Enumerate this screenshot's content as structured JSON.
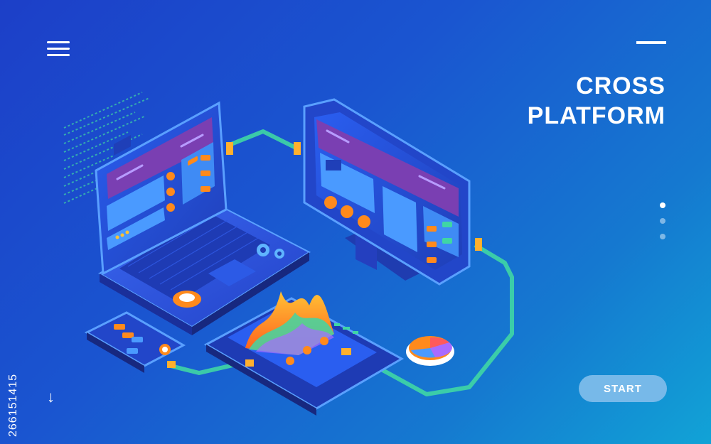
{
  "hero": {
    "title_line1": "CROSS",
    "title_line2": "PLATFORM",
    "start_label": "START"
  },
  "side_id": "266151415",
  "colors": {
    "accent_orange": "#ff8a1c",
    "accent_purple": "#6a4bb0",
    "pipe_green": "#3fd6a4",
    "button_blue": "#77b9e9"
  },
  "icons": {
    "menu": "hamburger-icon",
    "scroll": "arrow-down-icon",
    "mail": "mail-icon",
    "gear": "gear-icon",
    "star": "star-icon",
    "chat": "chat-bubble-icon"
  }
}
